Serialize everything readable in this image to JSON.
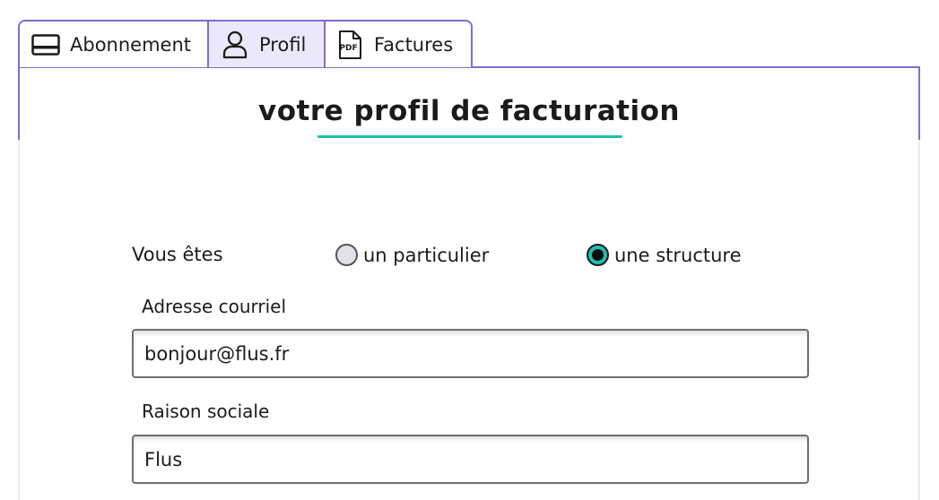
{
  "tabs": [
    {
      "label": "Abonnement",
      "icon": "card-icon",
      "active": false
    },
    {
      "label": "Profil",
      "icon": "user-icon",
      "active": true
    },
    {
      "label": "Factures",
      "icon": "pdf-file-icon",
      "active": false
    }
  ],
  "pdf_icon_text": "PDF",
  "page_title": "votre profil de facturation",
  "accent_color": "#1fbfae",
  "border_color": "#7b6fcf",
  "account_type": {
    "label": "Vous êtes",
    "options": [
      {
        "label": "un particulier",
        "checked": false
      },
      {
        "label": "une structure",
        "checked": true
      }
    ]
  },
  "fields": {
    "email": {
      "label": "Adresse courriel",
      "value": "bonjour@flus.fr"
    },
    "company_name": {
      "label": "Raison sociale",
      "value": "Flus"
    }
  }
}
